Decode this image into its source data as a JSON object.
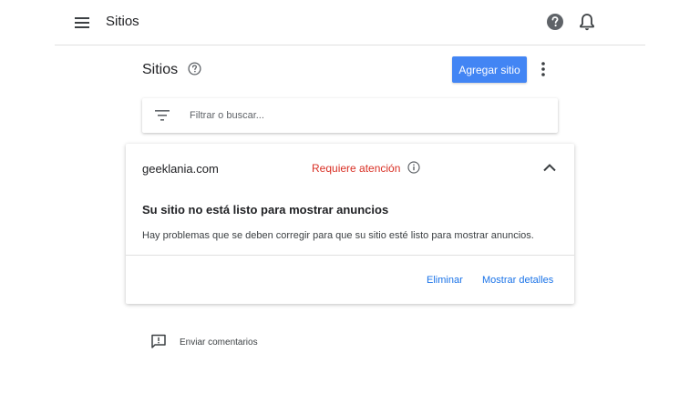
{
  "header": {
    "title": "Sitios",
    "menu_icon": "menu-icon",
    "help_icon": "help-icon",
    "notifications_icon": "bell-icon"
  },
  "page": {
    "title": "Sitios",
    "help_icon": "help-outline-icon",
    "add_site_label": "Agregar sitio",
    "more_icon": "more-vert-icon"
  },
  "filter": {
    "placeholder": "Filtrar o buscar...",
    "value": "",
    "icon": "filter-icon"
  },
  "site": {
    "name": "geeklania.com",
    "status": "Requiere atención",
    "status_color": "#d93025",
    "heading": "Su sitio no está listo para mostrar anuncios",
    "description": "Hay problemas que se deben corregir para que su sitio esté listo para mostrar anuncios.",
    "remove_label": "Eliminar",
    "details_label": "Mostrar detalles"
  },
  "feedback": {
    "label": "Enviar comentarios",
    "icon": "feedback-icon"
  },
  "colors": {
    "accent": "#4285f4",
    "link": "#1a73e8",
    "warning": "#d93025"
  }
}
